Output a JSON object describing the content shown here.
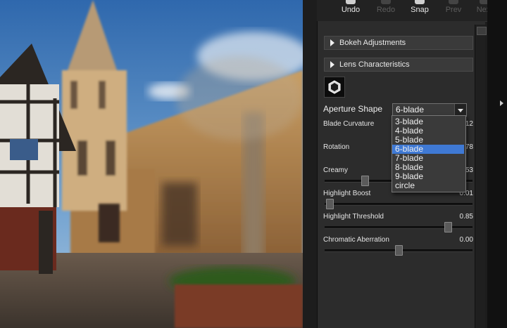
{
  "toolbar": {
    "undo": "Undo",
    "redo": "Redo",
    "snap": "Snap",
    "prev": "Prev",
    "next": "Next"
  },
  "sections": {
    "bokeh": "Bokeh Adjustments",
    "lens": "Lens Characteristics"
  },
  "aperture": {
    "label": "Aperture Shape",
    "selected": "6-blade",
    "options": [
      "3-blade",
      "4-blade",
      "5-blade",
      "6-blade",
      "7-blade",
      "8-blade",
      "9-blade",
      "circle"
    ]
  },
  "params": {
    "blade_curvature": {
      "label": "Blade Curvature",
      "value": "12"
    },
    "rotation": {
      "label": "Rotation",
      "value": "78"
    },
    "creamy": {
      "label": "Creamy",
      "value": "53",
      "level": 0.26
    },
    "highlight_boost": {
      "label": "Highlight Boost",
      "value": "0.01",
      "level": 0.01
    },
    "highlight_threshold": {
      "label": "Highlight Threshold",
      "value": "0.85",
      "level": 0.85
    },
    "chromatic_aberration": {
      "label": "Chromatic Aberration",
      "value": "0.00",
      "level": 0.5
    }
  },
  "icons": [
    "undo-icon",
    "redo-icon",
    "snap-icon",
    "prev-icon",
    "next-icon",
    "hexagon-aperture-icon",
    "disclosure-triangle-icon",
    "dropdown-caret-icon"
  ],
  "colors": {
    "selection": "#3f79d4",
    "panel": "#2c2c2c"
  }
}
